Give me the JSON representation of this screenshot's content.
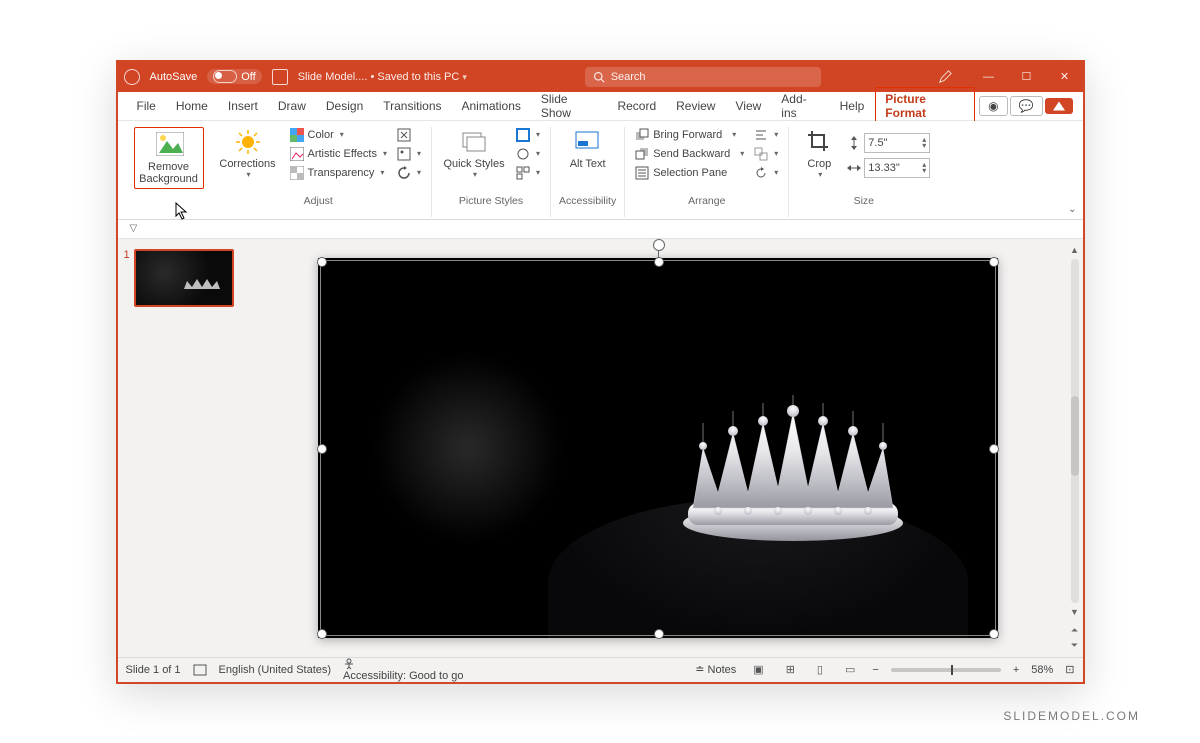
{
  "titlebar": {
    "autosave_label": "AutoSave",
    "autosave_state": "Off",
    "doc_title": "Slide Model....",
    "save_state": "Saved to this PC",
    "search_placeholder": "Search"
  },
  "tabs": {
    "items": [
      "File",
      "Home",
      "Insert",
      "Draw",
      "Design",
      "Transitions",
      "Animations",
      "Slide Show",
      "Record",
      "Review",
      "View",
      "Add-ins",
      "Help",
      "Picture Format"
    ],
    "active": "Picture Format"
  },
  "ribbon": {
    "remove_bg": "Remove Background",
    "corrections": "Corrections",
    "color": "Color",
    "artistic": "Artistic Effects",
    "transparency": "Transparency",
    "adjust_label": "Adjust",
    "quick_styles": "Quick Styles",
    "picture_styles_label": "Picture Styles",
    "alt_text": "Alt Text",
    "accessibility_label": "Accessibility",
    "bring_forward": "Bring Forward",
    "send_backward": "Send Backward",
    "selection_pane": "Selection Pane",
    "arrange_label": "Arrange",
    "crop": "Crop",
    "height_value": "7.5\"",
    "width_value": "13.33\"",
    "size_label": "Size"
  },
  "thumbs": {
    "slide1_num": "1"
  },
  "statusbar": {
    "slide_info": "Slide 1 of 1",
    "language": "English (United States)",
    "accessibility": "Accessibility: Good to go",
    "notes": "Notes",
    "zoom": "58%"
  },
  "watermark": "SLIDEMODEL.COM"
}
